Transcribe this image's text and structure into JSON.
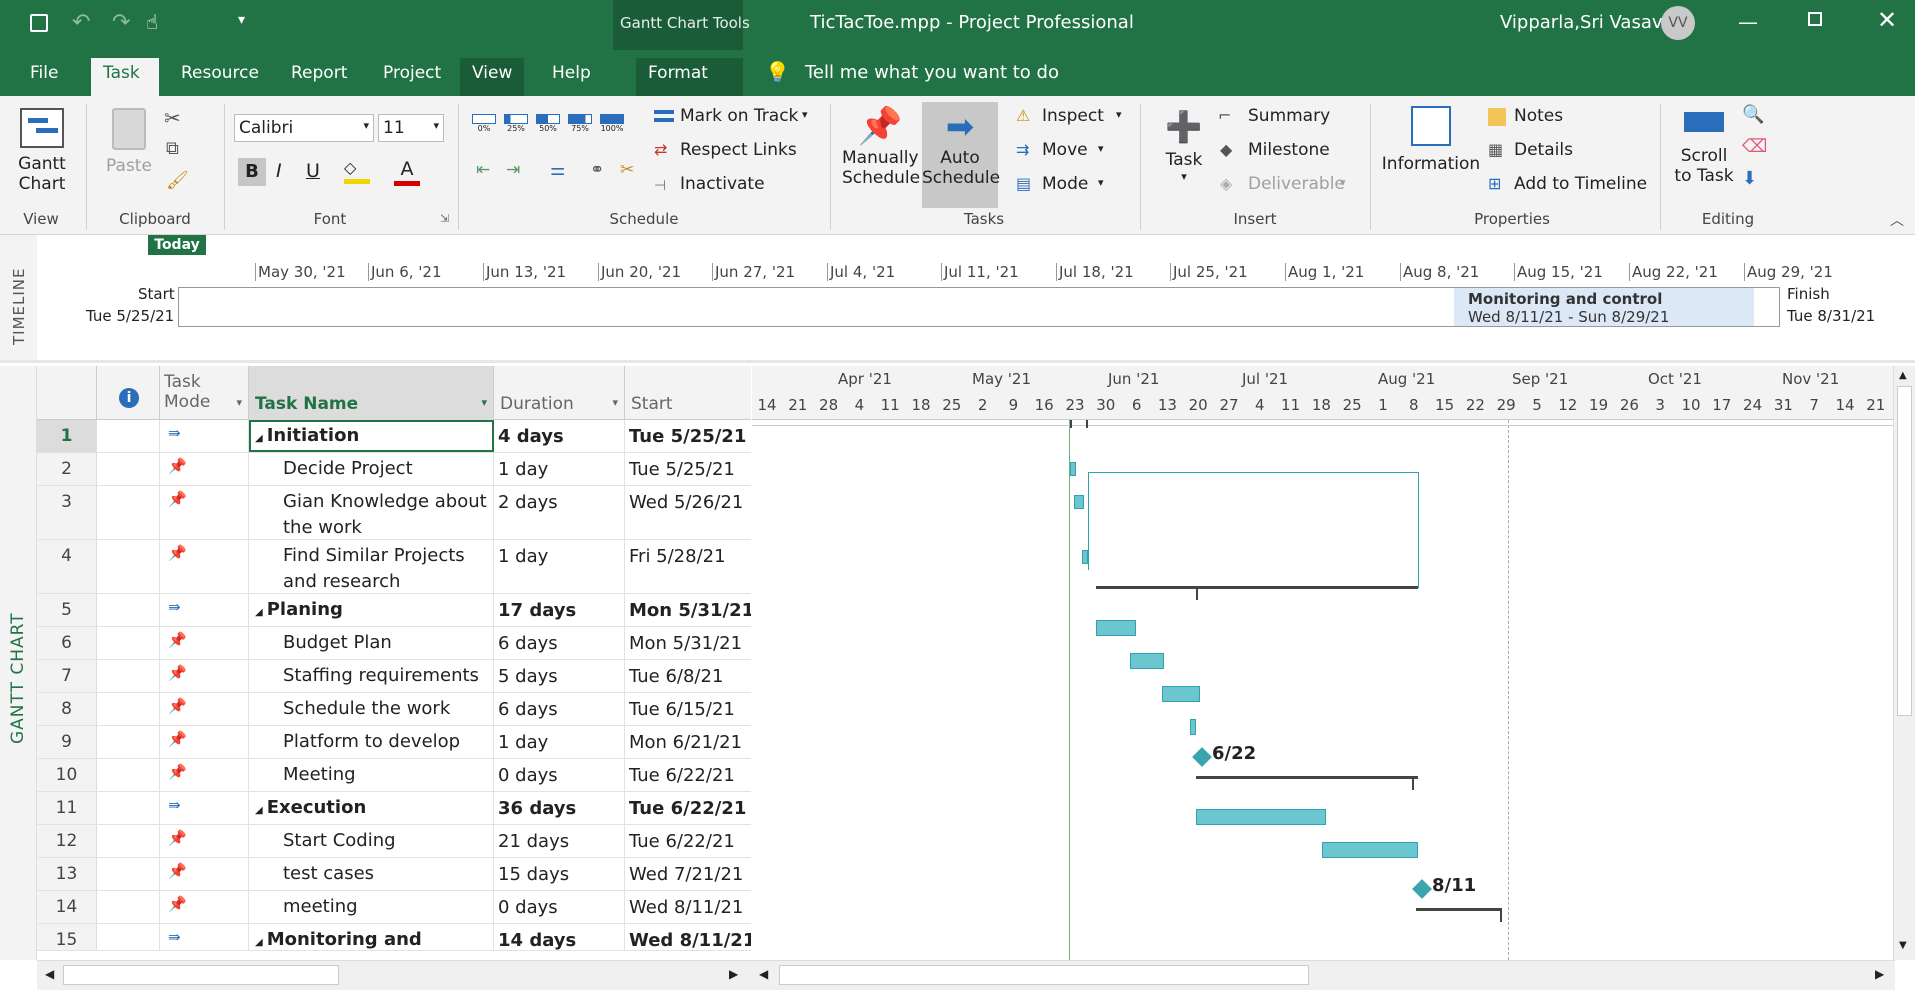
{
  "app": {
    "contextual": "Gantt Chart Tools",
    "title": "TicTacToe.mpp  -  Project Professional",
    "user": "Vipparla,Sri Vasavi",
    "initials": "VV"
  },
  "tabs": [
    "File",
    "Task",
    "Resource",
    "Report",
    "Project",
    "View",
    "Help",
    "Format"
  ],
  "tell_me": "Tell me what you want to do",
  "ribbon": {
    "view": {
      "gantt": "Gantt",
      "chart": "Chart",
      "label": "View"
    },
    "clipboard": {
      "paste": "Paste",
      "label": "Clipboard"
    },
    "font": {
      "family": "Calibri",
      "size": "11",
      "bold": "B",
      "italic": "I",
      "underline": "U",
      "label": "Font"
    },
    "schedule": {
      "pct": [
        "0%",
        "25%",
        "50%",
        "75%",
        "100%"
      ],
      "mark": "Mark on Track",
      "respect": "Respect Links",
      "inactivate": "Inactivate",
      "label": "Schedule"
    },
    "tasks": {
      "manual1": "Manually",
      "manual2": "Schedule",
      "auto1": "Auto",
      "auto2": "Schedule",
      "inspect": "Inspect",
      "move": "Move",
      "mode": "Mode",
      "label": "Tasks"
    },
    "insert": {
      "task": "Task",
      "summary": "Summary",
      "milestone": "Milestone",
      "deliverable": "Deliverable",
      "label": "Insert"
    },
    "properties": {
      "information": "Information",
      "notes": "Notes",
      "details": "Details",
      "add_timeline": "Add to Timeline",
      "label": "Properties"
    },
    "editing": {
      "scroll1": "Scroll",
      "scroll2": "to Task",
      "label": "Editing"
    }
  },
  "timeline": {
    "side": "TIMELINE",
    "today": "Today",
    "start_label": "Start",
    "start_date": "Tue 5/25/21",
    "finish_label": "Finish",
    "finish_date": "Tue 8/31/21",
    "dates": [
      "May 30, '21",
      "Jun 6, '21",
      "Jun 13, '21",
      "Jun 20, '21",
      "Jun 27, '21",
      "Jul 4, '21",
      "Jul 11, '21",
      "Jul 18, '21",
      "Jul 25, '21",
      "Aug 1, '21",
      "Aug 8, '21",
      "Aug 15, '21",
      "Aug 22, '21",
      "Aug 29, '21"
    ],
    "bar_title": "Monitoring and control",
    "bar_dates": "Wed 8/11/21 - Sun 8/29/21"
  },
  "gantt_side": "GANTT CHART",
  "columns": {
    "info": "i",
    "mode1": "Task",
    "mode2": "Mode",
    "name": "Task Name",
    "duration": "Duration",
    "start": "Start"
  },
  "rows": [
    {
      "id": "1",
      "name": "Initiation",
      "duration": "4 days",
      "start": "Tue 5/25/21",
      "summary": true
    },
    {
      "id": "2",
      "name": "Decide Project",
      "duration": "1 day",
      "start": "Tue 5/25/21"
    },
    {
      "id": "3",
      "name": "Gian Knowledge about",
      "name2": "the work",
      "duration": "2 days",
      "start": "Wed 5/26/21"
    },
    {
      "id": "4",
      "name": "Find Similar Projects",
      "name2": "and research",
      "duration": "1 day",
      "start": "Fri 5/28/21"
    },
    {
      "id": "5",
      "name": "Planing",
      "duration": "17 days",
      "start": "Mon 5/31/21",
      "summary": true
    },
    {
      "id": "6",
      "name": "Budget Plan",
      "duration": "6 days",
      "start": "Mon 5/31/21"
    },
    {
      "id": "7",
      "name": "Staffing requirements",
      "duration": "5 days",
      "start": "Tue 6/8/21"
    },
    {
      "id": "8",
      "name": "Schedule the work",
      "duration": "6 days",
      "start": "Tue 6/15/21"
    },
    {
      "id": "9",
      "name": "Platform to develop",
      "duration": "1 day",
      "start": "Mon 6/21/21"
    },
    {
      "id": "10",
      "name": "Meeting",
      "duration": "0 days",
      "start": "Tue 6/22/21"
    },
    {
      "id": "11",
      "name": "Execution",
      "duration": "36 days",
      "start": "Tue 6/22/21",
      "summary": true
    },
    {
      "id": "12",
      "name": "Start Coding",
      "duration": "21 days",
      "start": "Tue 6/22/21"
    },
    {
      "id": "13",
      "name": "test cases developmen",
      "duration": "15 days",
      "start": "Wed 7/21/21"
    },
    {
      "id": "14",
      "name": "meeting",
      "duration": "0 days",
      "start": "Wed 8/11/21"
    },
    {
      "id": "15",
      "name": "Monitoring and control",
      "duration": "14 days",
      "start": "Wed 8/11/21",
      "summary": true
    }
  ],
  "chart": {
    "months": [
      "Apr '21",
      "May '21",
      "Jun '21",
      "Jul '21",
      "Aug '21",
      "Sep '21",
      "Oct '21",
      "Nov '21"
    ],
    "days": [
      "14",
      "21",
      "28",
      "4",
      "11",
      "18",
      "25",
      "2",
      "9",
      "16",
      "23",
      "30",
      "6",
      "13",
      "20",
      "27",
      "4",
      "11",
      "18",
      "25",
      "1",
      "8",
      "15",
      "22",
      "29",
      "5",
      "12",
      "19",
      "26",
      "3",
      "10",
      "17",
      "24",
      "31",
      "7",
      "14",
      "21"
    ],
    "milestone1": "6/22",
    "milestone2": "8/11"
  }
}
